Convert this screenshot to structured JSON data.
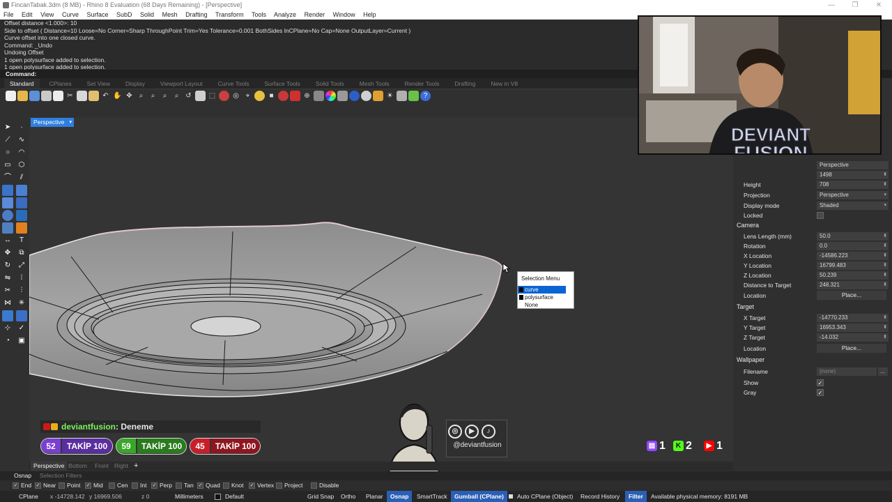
{
  "window": {
    "title": "FincanTabak.3dm (8 MB) - Rhino 8 Evaluation (68 Days Remaining) - [Perspective]",
    "controls": [
      "—",
      "❐",
      "✕"
    ]
  },
  "menu": [
    "File",
    "Edit",
    "View",
    "Curve",
    "Surface",
    "SubD",
    "Solid",
    "Mesh",
    "Drafting",
    "Transform",
    "Tools",
    "Analyze",
    "Render",
    "Window",
    "Help"
  ],
  "command_history": [
    "Offset distance <1.000>: 10",
    "Side to offset ( Distance=10  Loose=No  Corner=Sharp  ThroughPoint  Trim=Yes  Tolerance=0.001  BothSides  InCPlane=No  Cap=None  OutputLayer=Current )",
    "Curve offset into one closed curve.",
    "Command: _Undo",
    "Undoing Offset",
    "1 open polysurface added to selection.",
    "1 open polysurface added to selection."
  ],
  "command_prompt": "Command:",
  "toolbar_tabs": [
    "Standard",
    "CPlanes",
    "Set View",
    "Display",
    "Viewport Layout",
    "Curve Tools",
    "Surface Tools",
    "Solid Tools",
    "Mesh Tools",
    "Render Tools",
    "Drafting",
    "New in V8"
  ],
  "toolbar_tab_active": "Standard",
  "viewport": {
    "label": "Perspective",
    "dropdown": "▾"
  },
  "selection_menu": {
    "title": "Selection Menu",
    "items": [
      "curve",
      "polysurface",
      "None"
    ],
    "highlighted": "curve"
  },
  "properties": {
    "title_value": "Perspective",
    "width_value": "1498",
    "height_label": "Height",
    "height_value": "708",
    "projection_label": "Projection",
    "projection_value": "Perspective",
    "display_mode_label": "Display mode",
    "display_mode_value": "Shaded",
    "locked_label": "Locked",
    "camera_section": "Camera",
    "lens_label": "Lens Length (mm)",
    "lens_value": "50.0",
    "rotation_label": "Rotation",
    "rotation_value": "0.0",
    "xloc_label": "X Location",
    "xloc_value": "-14586.223",
    "yloc_label": "Y Location",
    "yloc_value": "16799.483",
    "zloc_label": "Z Location",
    "zloc_value": "50.239",
    "dist_label": "Distance to Target",
    "dist_value": "248.321",
    "location_label": "Location",
    "place_button": "Place...",
    "target_section": "Target",
    "xt_label": "X Target",
    "xt_value": "-14770.233",
    "yt_label": "Y Target",
    "yt_value": "16953.343",
    "zt_label": "Z Target",
    "zt_value": "-14.032",
    "tlocation_label": "Location",
    "tplace_button": "Place...",
    "wallpaper_section": "Wallpaper",
    "filename_label": "Filename",
    "filename_value": "(none)",
    "filename_button": "...",
    "show_label": "Show",
    "gray_label": "Gray"
  },
  "stream": {
    "chat_user": "deviantfusion",
    "chat_message": ": Deneme",
    "goals": [
      {
        "num": "52",
        "text": "TAKİP 100",
        "color": "#7a3fd0"
      },
      {
        "num": "59",
        "text": "TAKİP 100",
        "color": "#3aa62a"
      },
      {
        "num": "45",
        "text": "TAKİP 100",
        "color": "#c81e2a"
      }
    ],
    "social_handle": "@deviantfusion",
    "social_icons": [
      "instagram-icon",
      "youtube-icon",
      "tiktok-icon"
    ],
    "brand_text_1": "DEVIANT",
    "brand_text_2": "FUSION",
    "platform_counts": [
      {
        "platform": "twitch",
        "count": "1",
        "color": "#9146ff"
      },
      {
        "platform": "kick",
        "count": "2",
        "color": "#53fc18"
      },
      {
        "platform": "youtube",
        "count": "1",
        "color": "#ff0000"
      }
    ]
  },
  "viewport_tabs": [
    "Perspective",
    "Bottom",
    "Front",
    "Right"
  ],
  "viewport_tab_add": "+",
  "osnap_tabs": [
    "Osnap",
    "Selection Filters"
  ],
  "osnaps": [
    {
      "label": "End",
      "checked": true
    },
    {
      "label": "Near",
      "checked": true
    },
    {
      "label": "Point",
      "checked": false
    },
    {
      "label": "Mid",
      "checked": true
    },
    {
      "label": "Cen",
      "checked": false
    },
    {
      "label": "Int",
      "checked": false
    },
    {
      "label": "Perp",
      "checked": true
    },
    {
      "label": "Tan",
      "checked": false
    },
    {
      "label": "Quad",
      "checked": true
    },
    {
      "label": "Knot",
      "checked": false
    },
    {
      "label": "Vertex",
      "checked": true
    },
    {
      "label": "Project",
      "checked": false
    },
    {
      "label": "Disable",
      "checked": false
    }
  ],
  "status": {
    "cplane": "CPlane",
    "x": "x -14728.142",
    "y": "y 16969.506",
    "z": "z 0",
    "units": "Millimeters",
    "layer": "Default",
    "grid_snap": "Grid Snap",
    "ortho": "Ortho",
    "planar": "Planar",
    "osnap": "Osnap",
    "smarttrack": "SmartTrack",
    "gumball": "Gumball (CPlane)",
    "autocplane": "Auto CPlane (Object)",
    "record_history": "Record History",
    "filter": "Filter",
    "memory": "Available physical memory: 8191 MB"
  }
}
